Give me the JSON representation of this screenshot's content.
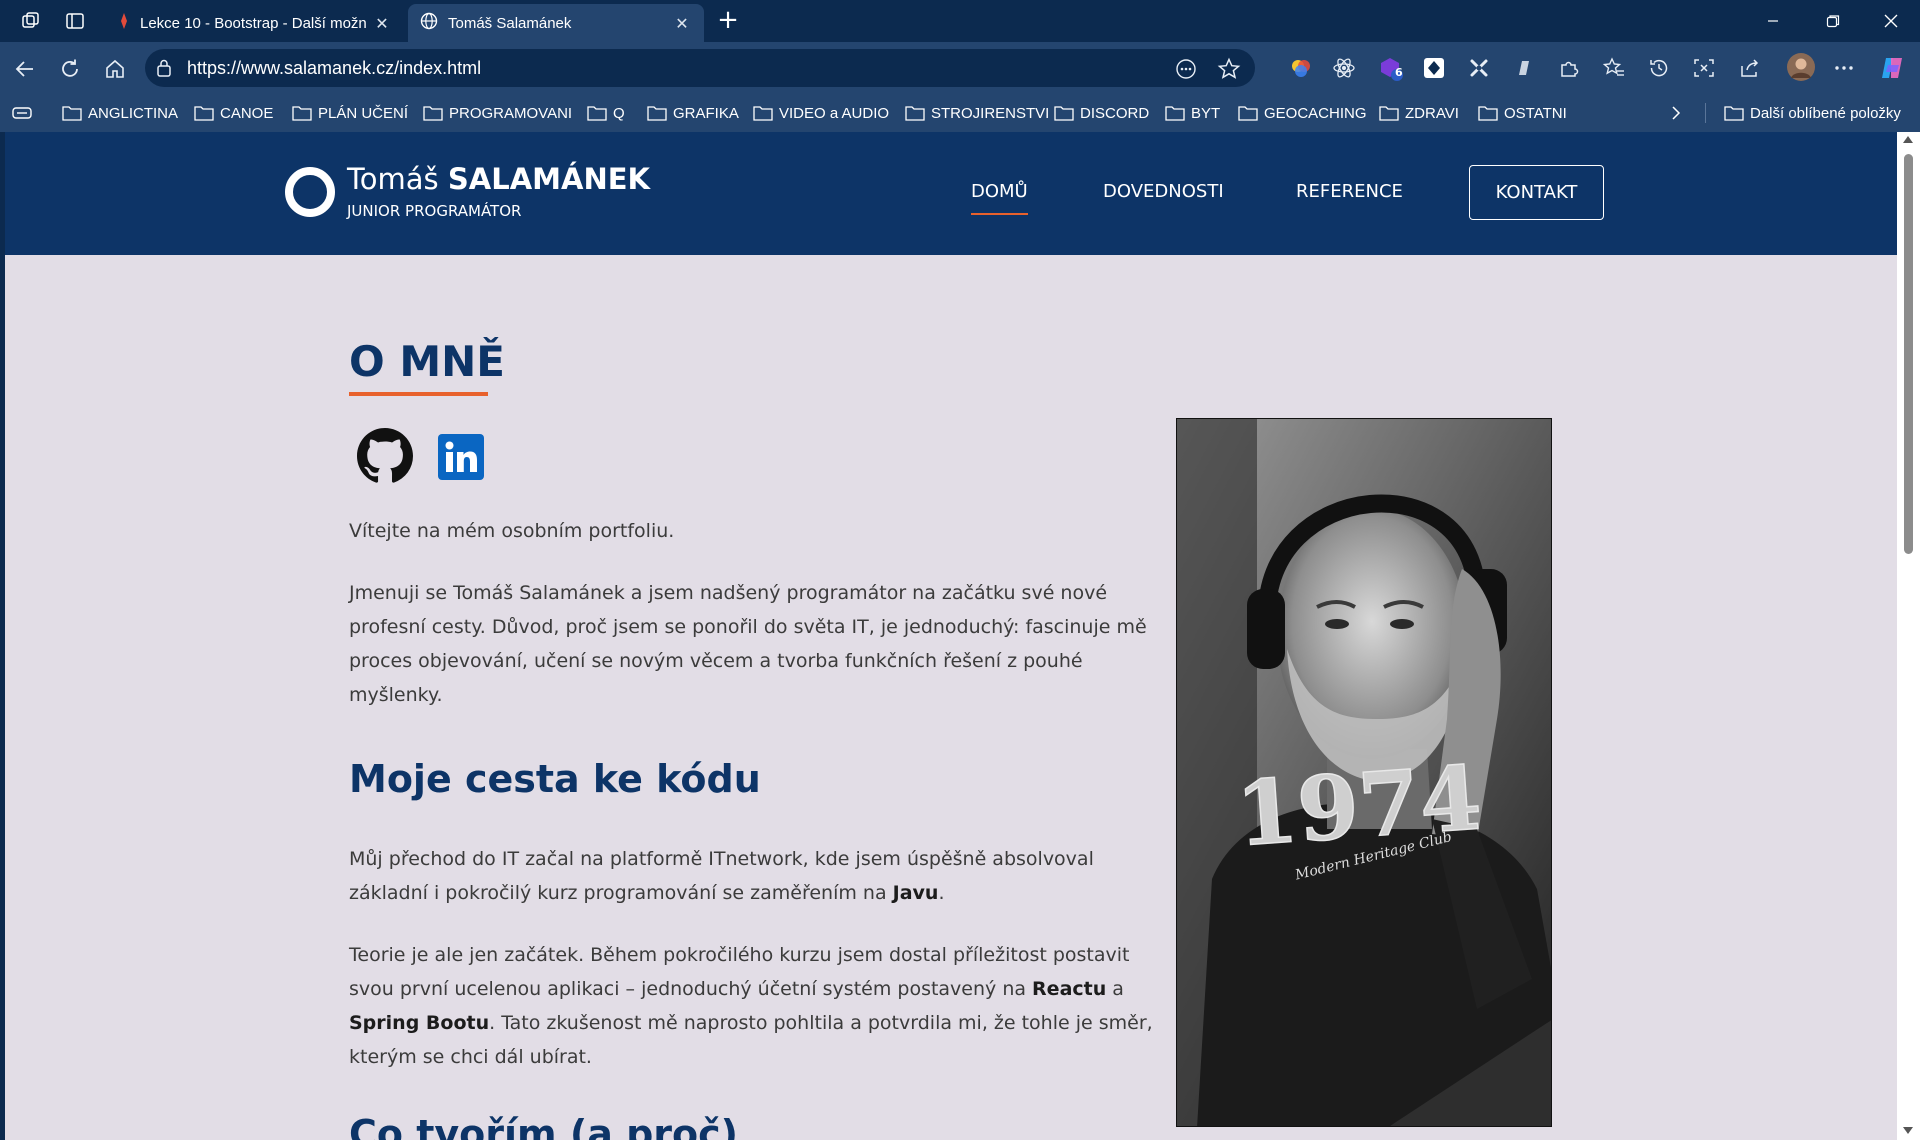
{
  "browser": {
    "tabs": [
      {
        "title": "Lekce 10 - Bootstrap - Další možn",
        "active": false
      },
      {
        "title": "Tomáš Salamánek",
        "active": true
      }
    ],
    "url": "https://www.salamanek.cz/index.html",
    "extension_badge": "6",
    "bookmarks": [
      "ANGLICTINA",
      "CANOE",
      "PLÁN UČENÍ",
      "PROGRAMOVANI",
      "Q",
      "GRAFIKA",
      "VIDEO a AUDIO",
      "STROJIRENSTVI",
      "DISCORD",
      "BYT",
      "GEOCACHING",
      "ZDRAVI",
      "OSTATNI"
    ],
    "other_bookmarks": "Další oblíbené položky"
  },
  "site": {
    "brand": {
      "first_name": "Tomáš",
      "last_name": "SALAMÁNEK",
      "subtitle": "JUNIOR PROGRAMÁTOR"
    },
    "menu": {
      "home": "DOMŮ",
      "skills": "DOVEDNOSTI",
      "references": "REFERENCE",
      "contact": "KONTAKT"
    },
    "about": {
      "heading": "O MNĚ",
      "welcome": "Vítejte na mém osobním portfoliu.",
      "intro": "Jmenuji se Tomáš Salamánek a jsem nadšený programátor na začátku své nové profesní cesty. Důvod, proč jsem se ponořil do světa IT, je jednoduchý: fascinuje mě proces objevování, učení se novým věcem a tvorba funkčních řešení z pouhé myšlenky.",
      "journey_heading": "Moje cesta ke kódu",
      "journey_p1_pre": "Můj přechod do IT začal na platformě ITnetwork, kde jsem úspěšně absolvoval základní i pokročilý kurz programování se zaměřením na ",
      "journey_p1_bold": "Javu",
      "journey_p1_post": ".",
      "journey_p2_pre": "Teorie je ale jen začátek. Během pokročilého kurzu jsem dostal příležitost postavit svou první ucelenou aplikaci – jednoduchý účetní systém postavený na ",
      "journey_p2_b1": "Reactu",
      "journey_p2_mid": " a ",
      "journey_p2_b2": "Spring Bootu",
      "journey_p2_post": ". Tato zkušenost mě naprosto pohltila a potvrdila mi, že tohle je směr, kterým se chci dál ubírat.",
      "next_heading_cut": "Co tvořím (a proč)"
    },
    "colors": {
      "header_bg": "#0d3467",
      "accent": "#e8612c",
      "page_bg": "#e2dde6"
    },
    "photo_print_text": [
      "1974",
      "Modern Heritage Club"
    ]
  }
}
